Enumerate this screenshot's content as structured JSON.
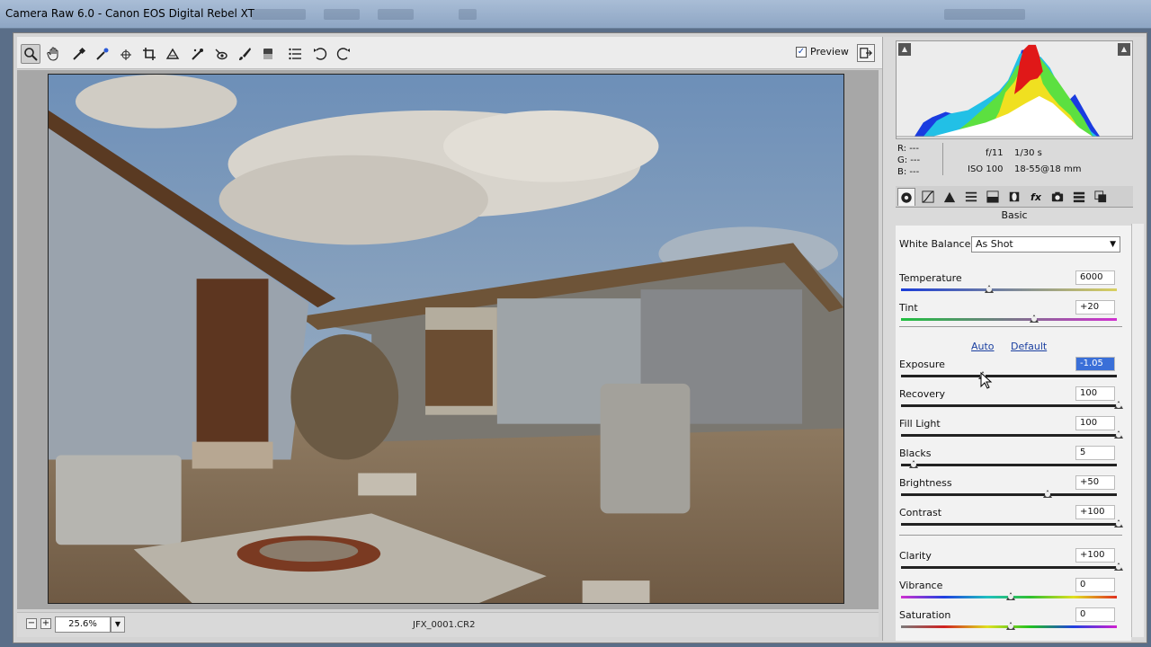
{
  "titlebar": {
    "title": "Camera Raw 6.0  -  Canon EOS Digital Rebel XT"
  },
  "toolbar": {
    "tools": [
      "zoom-tool-icon",
      "hand-tool-icon",
      "white-balance-tool-icon",
      "color-sampler-tool-icon",
      "targeted-adjustment-tool-icon",
      "crop-tool-icon",
      "straighten-tool-icon",
      "spot-removal-icon",
      "red-eye-removal-icon",
      "adjustment-brush-icon",
      "graduated-filter-icon",
      "preferences-icon",
      "rotate-left-icon",
      "rotate-right-icon"
    ],
    "preview_label": "Preview",
    "preview_checked": true
  },
  "status": {
    "zoom": "25.6%",
    "filename": "JFX_0001.CR2",
    "zoom_out": "−",
    "zoom_in": "+",
    "zoom_dd": "▼"
  },
  "info": {
    "r": "R:  ---",
    "g": "G:  ---",
    "b": "B:  ---",
    "aperture": "f/11",
    "shutter": "1/30 s",
    "iso": "ISO 100",
    "lens": "18-55@18 mm"
  },
  "panel": {
    "tab_name": "Basic",
    "white_balance_label": "White Balance:",
    "white_balance_value": "As Shot",
    "auto_label": "Auto",
    "default_label": "Default"
  },
  "sliders": [
    {
      "label": "Temperature",
      "value": "6000",
      "pos": 0.4
    },
    {
      "label": "Tint",
      "value": "+20",
      "pos": 0.61
    },
    {
      "label": "Exposure",
      "value": "-1.05",
      "pos": 0.37
    },
    {
      "label": "Recovery",
      "value": "100",
      "pos": 1.0
    },
    {
      "label": "Fill Light",
      "value": "100",
      "pos": 1.0
    },
    {
      "label": "Blacks",
      "value": "5",
      "pos": 0.05
    },
    {
      "label": "Brightness",
      "value": "+50",
      "pos": 0.67
    },
    {
      "label": "Contrast",
      "value": "+100",
      "pos": 1.0
    },
    {
      "label": "Clarity",
      "value": "+100",
      "pos": 1.0
    },
    {
      "label": "Vibrance",
      "value": "0",
      "pos": 0.5
    },
    {
      "label": "Saturation",
      "value": "0",
      "pos": 0.5
    }
  ]
}
